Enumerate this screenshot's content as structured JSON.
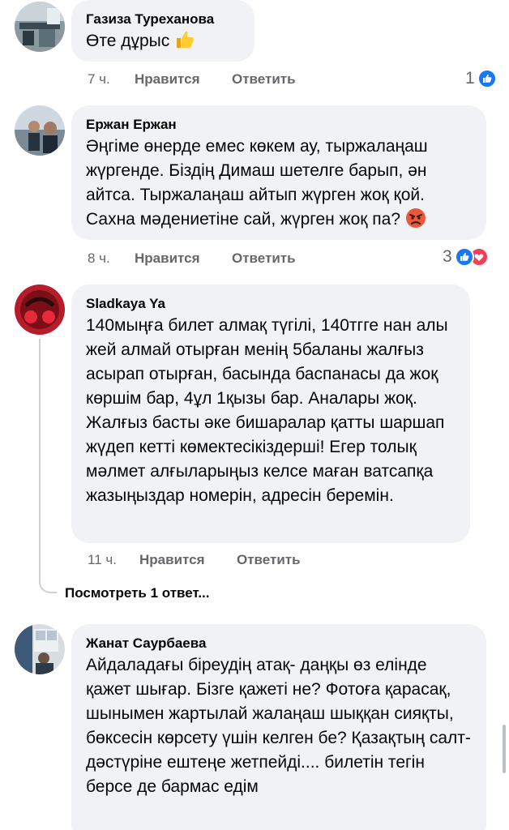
{
  "comments": [
    {
      "author": "Газиза Туреханова",
      "text": "Өте дұрыс",
      "time": "7 ч.",
      "like_label": "Нравится",
      "reply_label": "Ответить",
      "reaction_count": "1",
      "reactions": [
        "like-icon"
      ],
      "emoji": "thumbs-up-icon"
    },
    {
      "author": "Ержан Ержан",
      "text": "Әңгіме өнерде емес көкем ау, тыржалаңаш жүргенде. Біздің Димаш шетелге барып, ән айтса. Тыржалаңаш айтып жүрген жоқ қой. Сахна мәдениетіне сай, жүрген жоқ па?",
      "time": "8 ч.",
      "like_label": "Нравится",
      "reply_label": "Ответить",
      "reaction_count": "3",
      "reactions": [
        "like-icon",
        "love-icon"
      ],
      "emoji": "angry-face-icon"
    },
    {
      "author": "Sladkaya Ya",
      "text": "140мыңға билет алмақ түгілі, 140тгге нан алы жей алмай отырған менің 5баланы жалғыз асырап отырған, басында баспанасы да жоқ көршім бар, 4ұл 1қызы бар. Аналары жоқ. Жалғыз басты әке бишаралар қатты шаршап жүдеп кетті көмектесікіздерші! Егер толық мәлмет алғыларыңыз келсе маған ватсапқа жазыңыздар номерін, адресін беремін.",
      "time": "11 ч.",
      "like_label": "Нравится",
      "reply_label": "Ответить",
      "view_replies": "Посмотреть 1 ответ..."
    },
    {
      "author": "Жанат Саурбаева",
      "text": "Айдаладағы біреудің атақ- даңқы өз елінде қажет шығар. Бізге қажеті не? Фотоға қарасақ, шынымен жартылай жалаңаш шыққан сияқты, бөксесін көрсету үшін келген бе? Қазақтың салт- дәстүріне ештеңе жетпейді.... билетін тегін берсе де бармас едім"
    }
  ],
  "colors": {
    "bubble": "#f0f2f5",
    "meta": "#65676b",
    "like_blue": "#1877f2",
    "love_red": "#f33e58"
  }
}
